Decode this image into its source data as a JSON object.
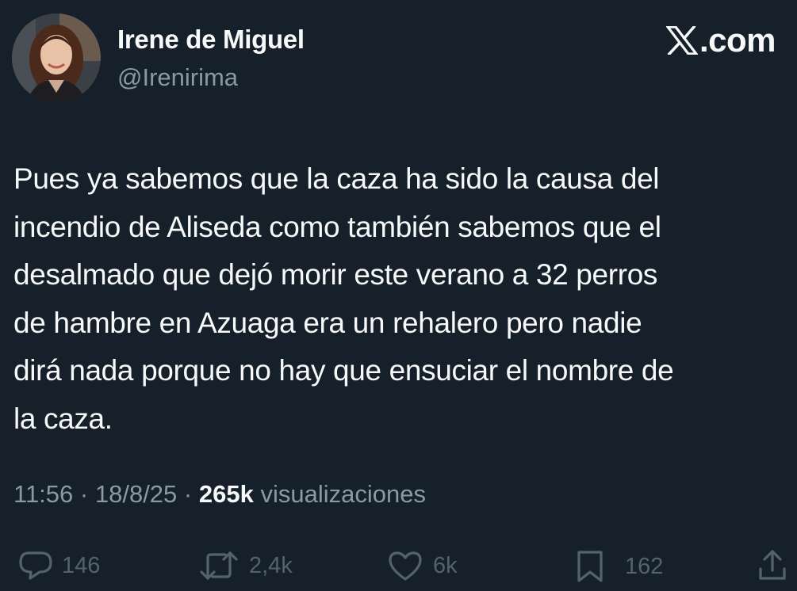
{
  "author": {
    "name": "Irene de Miguel",
    "handle": "@Irenirima"
  },
  "brand": {
    "label": ".com",
    "icon": "x-logo-icon"
  },
  "tweet": {
    "text": "Pues ya sabemos que la caza ha sido la causa del\nincendio de Aliseda como también sabemos que el\ndesalmado que dejó morir este verano a 32 perros\nde hambre en Azuaga era un rehalero pero nadie\ndirá nada porque no hay que ensuciar el nombre de\nla caza."
  },
  "meta": {
    "time": "11:56",
    "separator": "·",
    "date": "18/8/25",
    "views_count": "265k",
    "views_label": "visualizaciones"
  },
  "actions": {
    "replies": "146",
    "reposts": "2,4k",
    "likes": "6k",
    "bookmarks": "162"
  },
  "colors": {
    "background": "#15202b",
    "text": "#f7f9f9",
    "secondary": "#8b98a5"
  }
}
